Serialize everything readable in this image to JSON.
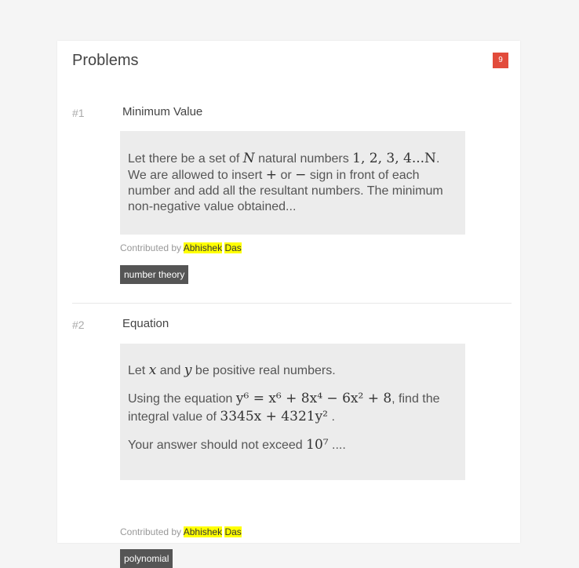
{
  "panel": {
    "title": "Problems",
    "count": "9"
  },
  "problems": [
    {
      "number": "#1",
      "title": "Minimum Value",
      "body": {
        "t1": "Let there be a set of ",
        "m1": "N",
        "t2": " natural numbers ",
        "m2": "1, 2, 3, 4...N",
        "t3": ". We are allowed to insert ",
        "m3": "+",
        "t4": " or ",
        "m4": "−",
        "t5": " sign in front of each number and add all the resultant numbers. The minimum non-negative value obtained..."
      },
      "contributed_by": "Contributed by",
      "author_first": "Abhishek",
      "author_last": "Das",
      "tag": "number theory"
    },
    {
      "number": "#2",
      "title": "Equation",
      "body": {
        "l1a": "Let ",
        "l1x": "x",
        "l1b": " and ",
        "l1y": "y",
        "l1c": " be positive real numbers.",
        "l2a": "Using the equation ",
        "l2m": "y⁶ = x⁶ + 8x⁴ − 6x² + 8",
        "l2b": ", find the integral value of ",
        "l2m2": "3345x + 4321y²",
        "l2c": " .",
        "l3a": "Your answer should not exceed ",
        "l3m": "10⁷",
        "l3b": " ...."
      },
      "contributed_by": "Contributed by",
      "author_first": "Abhishek",
      "author_last": "Das",
      "tag": "polynomial"
    }
  ],
  "colors": {
    "badge": "#e24b3b",
    "highlight": "#ffff00",
    "tag_bg": "#555555",
    "box_bg": "#ececec"
  }
}
